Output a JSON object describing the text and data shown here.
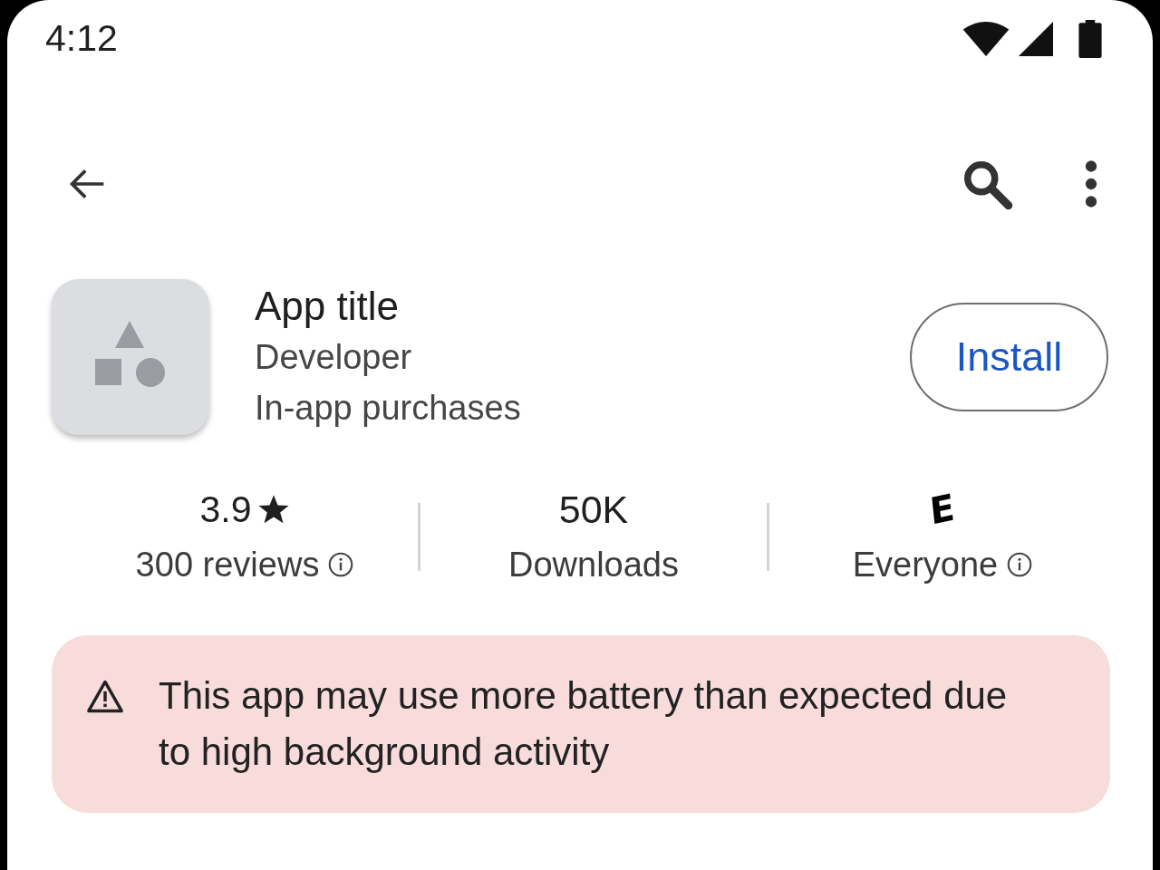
{
  "status_bar": {
    "time": "4:12"
  },
  "app": {
    "title": "App title",
    "developer": "Developer",
    "note": "In-app purchases",
    "install_button": "Install"
  },
  "stats": [
    {
      "kind": "rating",
      "value": "3.9",
      "label": "300 reviews",
      "info": true
    },
    {
      "kind": "count",
      "value": "50K",
      "label": "Downloads",
      "info": false
    },
    {
      "kind": "content-rating",
      "value": "E",
      "label": "Everyone",
      "info": true
    }
  ],
  "warning": {
    "text": "This app may use more battery than expected due to high background activity"
  }
}
